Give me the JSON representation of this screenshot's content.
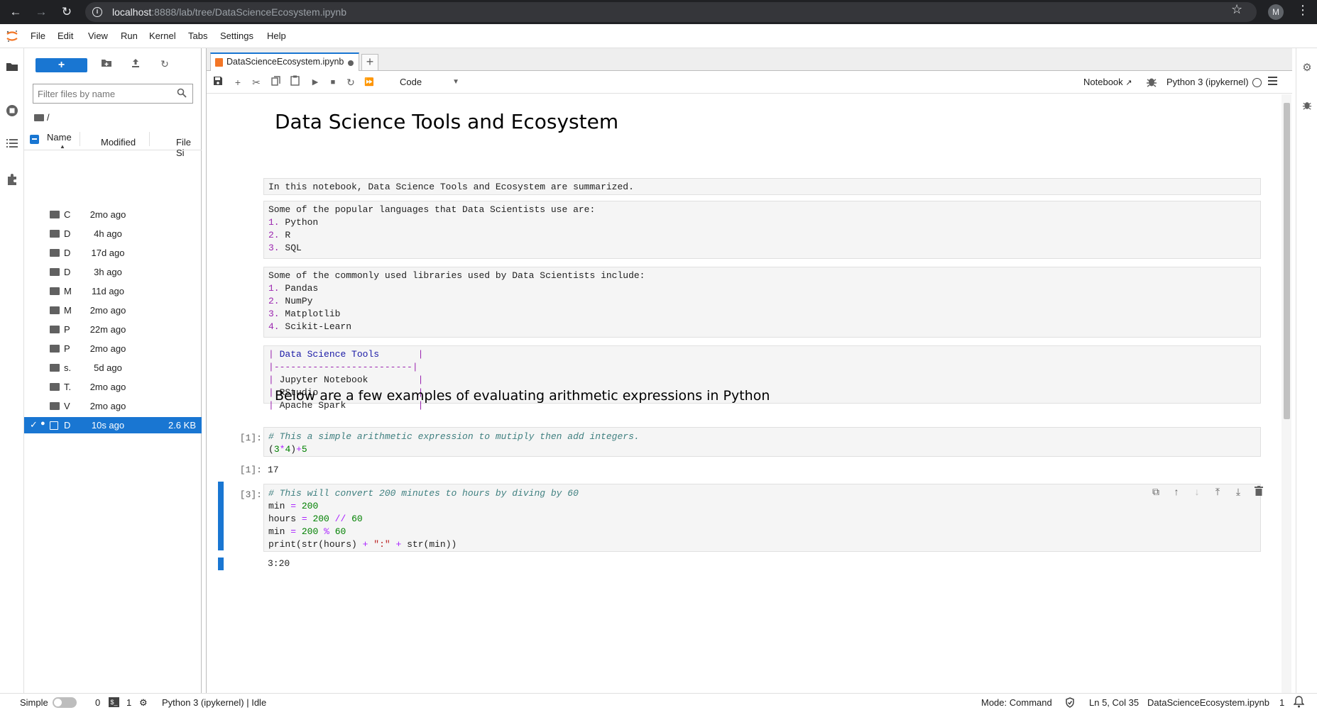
{
  "browser": {
    "url_host": "localhost",
    "url_path": ":8888/lab/tree/DataScienceEcosystem.ipynb",
    "profile_initial": "M"
  },
  "menu": [
    "File",
    "Edit",
    "View",
    "Run",
    "Kernel",
    "Tabs",
    "Settings",
    "Help"
  ],
  "filebrowser": {
    "filter_placeholder": "Filter files by name",
    "breadcrumb": "/",
    "col_name": "Name",
    "col_modified": "Modified",
    "col_size": "File Si",
    "files": [
      {
        "name": "C",
        "modified": "2mo ago",
        "size": ""
      },
      {
        "name": "D",
        "modified": "4h ago",
        "size": ""
      },
      {
        "name": "D",
        "modified": "17d ago",
        "size": ""
      },
      {
        "name": "D",
        "modified": "3h ago",
        "size": ""
      },
      {
        "name": "M",
        "modified": "11d ago",
        "size": ""
      },
      {
        "name": "M",
        "modified": "2mo ago",
        "size": ""
      },
      {
        "name": "P",
        "modified": "22m ago",
        "size": ""
      },
      {
        "name": "P",
        "modified": "2mo ago",
        "size": ""
      },
      {
        "name": "s.",
        "modified": "5d ago",
        "size": ""
      },
      {
        "name": "T.",
        "modified": "2mo ago",
        "size": ""
      },
      {
        "name": "V",
        "modified": "2mo ago",
        "size": ""
      },
      {
        "name": "D",
        "modified": "10s ago",
        "size": "2.6 KB"
      }
    ]
  },
  "tab": {
    "label": "DataScienceEcosystem.ipynb"
  },
  "toolbar": {
    "cell_type": "Code",
    "open_in": "Notebook",
    "kernel": "Python 3 (ipykernel)"
  },
  "notebook": {
    "title": "Data Science Tools and Ecosystem",
    "intro": "In this notebook, Data Science Tools and Ecosystem are summarized.",
    "languages_header": "Some of the popular languages that Data Scientists use are:",
    "languages": [
      "Python",
      "R",
      "SQL"
    ],
    "libraries_header": "Some of the commonly used libraries used by Data Scientists include:",
    "libraries": [
      "Pandas",
      "NumPy",
      "Matplotlib",
      "Scikit-Learn"
    ],
    "table_header": "Data Science Tools",
    "table_sep": "-------------------------",
    "tools": [
      "Jupyter Notebook",
      "RStudio",
      "Apache Spark"
    ],
    "subtitle": "Below are a few examples of evaluating arithmetic expressions in Python",
    "cell1_prompt": "[1]:",
    "cell1_comment": "# This a simple arithmetic expression to mutiply then add integers.",
    "cell1_out_prompt": "[1]:",
    "cell1_output": "17",
    "cell2_prompt": "[3]:",
    "cell2_comment": "# This will convert 200 minutes to hours by diving by 60",
    "cell2_output": "3:20"
  },
  "status": {
    "simple": "Simple",
    "terminals": "0",
    "kernels": "1",
    "kernel_state": "Python 3 (ipykernel) | Idle",
    "mode": "Mode: Command",
    "cursor": "Ln 5, Col 35",
    "filename": "DataScienceEcosystem.ipynb",
    "notifications": "1"
  },
  "colors": {
    "accent": "#1976d2",
    "notebook_icon": "#f37626"
  }
}
